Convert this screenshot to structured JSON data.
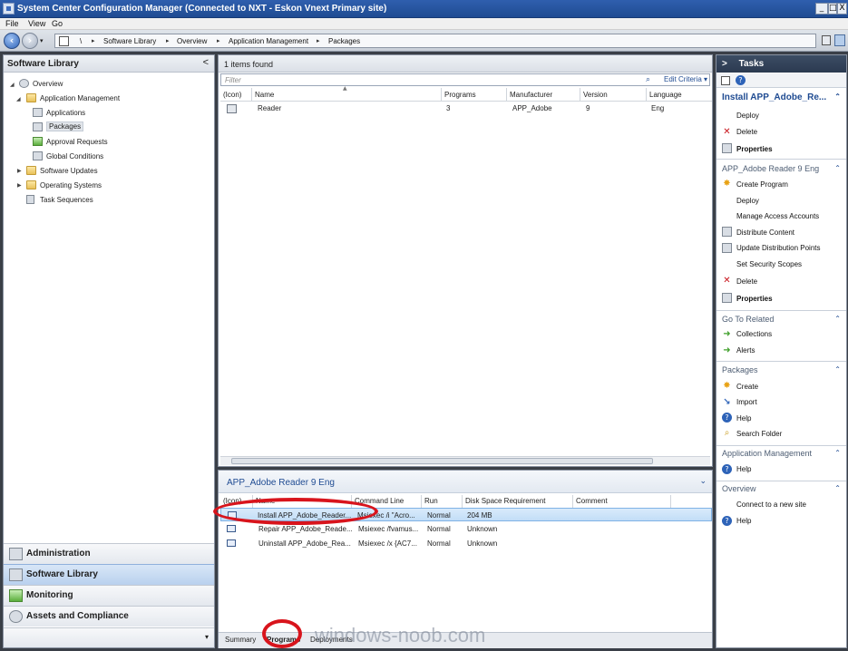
{
  "window": {
    "title": "System Center Configuration Manager (Connected to NXT - Eskon Vnext Primary site)",
    "min": "_",
    "max": "□",
    "close": "X"
  },
  "menu": {
    "file": "File",
    "view": "View",
    "go": "Go"
  },
  "address": {
    "root": "\\",
    "crumbs": [
      "Software Library",
      "Overview",
      "Application Management",
      "Packages"
    ],
    "sep": "▸"
  },
  "left_pane": {
    "header": "Software Library",
    "collapse": "<",
    "tree": {
      "overview": "Overview",
      "application_management": "Application Management",
      "applications": "Applications",
      "packages": "Packages",
      "approval_requests": "Approval Requests",
      "global_conditions": "Global Conditions",
      "software_updates": "Software Updates",
      "operating_systems": "Operating Systems",
      "task_sequences": "Task Sequences"
    },
    "grip": "........",
    "workspaces": [
      "Administration",
      "Software Library",
      "Monitoring",
      "Assets and Compliance"
    ],
    "chevron": "▾"
  },
  "list": {
    "count": "1 items found",
    "filter_placeholder": "Filter",
    "edit_criteria": "Edit Criteria ▾",
    "columns": [
      "(Icon)",
      "Name",
      "Programs",
      "Manufacturer",
      "Version",
      "Language"
    ],
    "rows": [
      {
        "name": "Reader",
        "programs": "3",
        "manufacturer": "APP_Adobe",
        "version": "9",
        "language": "Eng"
      }
    ]
  },
  "details": {
    "title": "APP_Adobe Reader 9 Eng",
    "chevron": "⌄",
    "columns": [
      "(Icon)",
      "Name",
      "Command Line",
      "Run",
      "Disk Space Requirement",
      "Comment"
    ],
    "rows": [
      {
        "name": "Install APP_Adobe_Reader...",
        "command": "Msiexec /i \"Acro...",
        "run": "Normal",
        "disk": "204 MB"
      },
      {
        "name": "Repair APP_Adobe_Reade...",
        "command": "Msiexec /fvamus...",
        "run": "Normal",
        "disk": "Unknown"
      },
      {
        "name": "Uninstall APP_Adobe_Rea...",
        "command": "Msiexec /x {AC7...",
        "run": "Normal",
        "disk": "Unknown"
      }
    ],
    "tabs": [
      "Summary",
      "Programs",
      "Deployments"
    ]
  },
  "watermark": "windows-noob.com",
  "tasks": {
    "header": "Tasks",
    "expand": ">",
    "help_glyph": "?",
    "program_section": {
      "title": "Install APP_Adobe_Re...",
      "items": [
        "Deploy",
        "Delete",
        "Properties"
      ]
    },
    "package_section": {
      "title": "APP_Adobe Reader 9 Eng",
      "items": [
        "Create Program",
        "Deploy",
        "Manage Access Accounts",
        "Distribute Content",
        "Update Distribution Points",
        "Set Security Scopes",
        "Delete",
        "Properties"
      ]
    },
    "go_to_related": {
      "title": "Go To Related",
      "items": [
        "Collections",
        "Alerts"
      ]
    },
    "packages": {
      "title": "Packages",
      "items": [
        "Create",
        "Import",
        "Help",
        "Search Folder"
      ]
    },
    "application_management": {
      "title": "Application Management",
      "items": [
        "Help"
      ]
    },
    "overview": {
      "title": "Overview",
      "items": [
        "Connect to a new site",
        "Help"
      ]
    }
  },
  "colors": {
    "accent": "#1f4b92",
    "title_bar": "#2f5fae",
    "highlight": "#d9ebfb",
    "annotation": "#d8141c"
  }
}
